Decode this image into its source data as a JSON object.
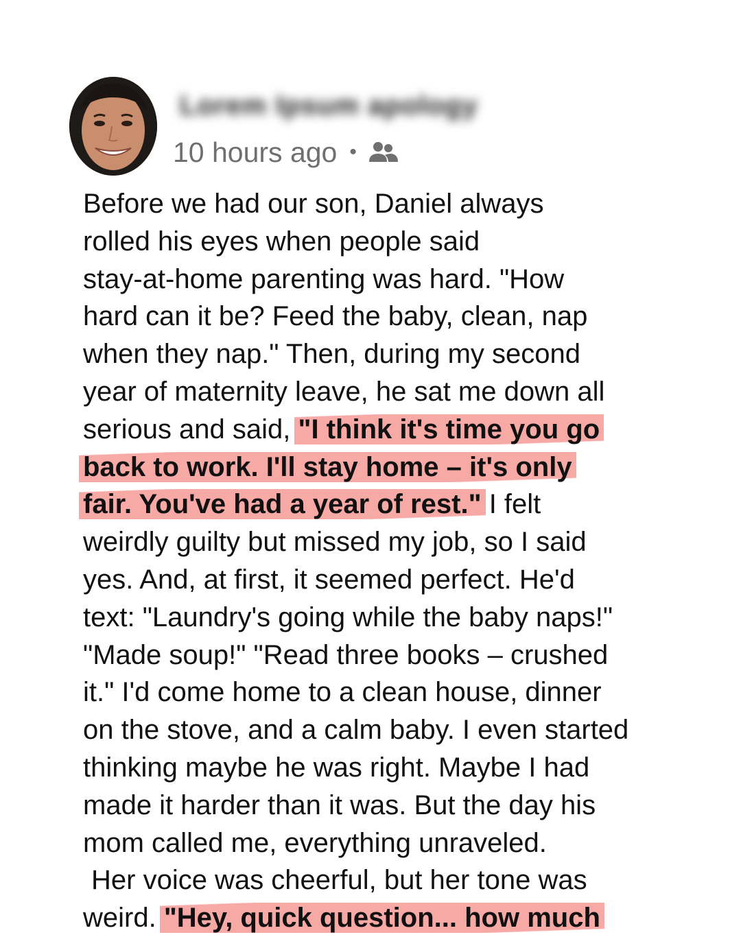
{
  "post": {
    "author_name": "Lorem Ipsum apology",
    "timestamp": "10 hours ago",
    "separator": "•",
    "audience_icon": "friends-icon",
    "avatar_icon": "avatar-photo",
    "highlight_color": "#f7a9a6",
    "lines": [
      "Before we had our son, Daniel always",
      "rolled his eyes when people said",
      "stay-at-home parenting was hard. \"How",
      "hard can it be? Feed the baby, clean, nap",
      "when they nap.\" Then, during my second",
      "year of maternity leave, he sat me down all"
    ],
    "line7_plain": "serious and said, ",
    "line7_highlight": "\"I think it's time you go",
    "line8_highlight": "back to work. I'll stay home – it's only",
    "line9_highlight": "fair. You've had a year of rest.\"",
    "line9_plain": " I felt",
    "lines_after": [
      "weirdly guilty but missed my job, so I said",
      "yes. And, at first, it seemed perfect. He'd",
      "text: \"Laundry's going while the baby naps!\"",
      "\"Made soup!\" \"Read three books – crushed",
      "it.\" I'd come home to a clean house, dinner",
      "on the stove, and a calm baby. I even started",
      "thinking maybe he was right. Maybe I had",
      "made it harder than it was. But the day his",
      "mom called me, everything unraveled."
    ],
    "line19": "Her voice was cheerful, but her tone was",
    "line20_plain": "weird. ",
    "line20_highlight": "\"Hey, quick question... how much"
  }
}
